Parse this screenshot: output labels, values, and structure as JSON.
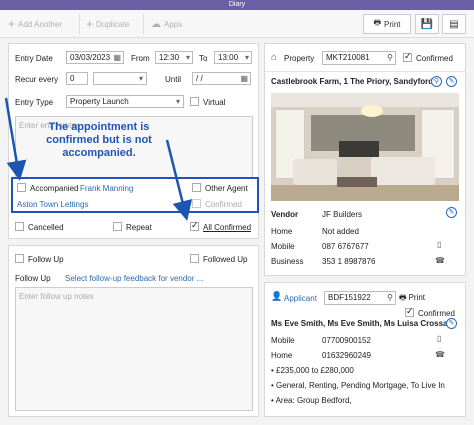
{
  "window": {
    "title": "Diary"
  },
  "toolbar": {
    "add_another": "Add Another",
    "duplicate": "Duplicate",
    "apps": "Apps",
    "print": "Print"
  },
  "entry": {
    "entry_date_label": "Entry Date",
    "entry_date": "03/03/2023",
    "from_label": "From",
    "from_time": "12:30",
    "to_label": "To",
    "to_time": "13:00",
    "recur_label": "Recur every",
    "recur_value": "0",
    "until_label": "Until",
    "until_value": "/ /",
    "entry_type_label": "Entry Type",
    "entry_type_value": "Property Launch",
    "virtual_label": "Virtual",
    "notes_placeholder": "Enter entry notes"
  },
  "annotation": {
    "text": "The appointment is confirmed but is not accompanied."
  },
  "accompanied": {
    "accompanied_label": "Accompanied",
    "accompanied_by": "Frank Manning",
    "other_agent_label": "Other Agent",
    "company": "Aston Town Lettings",
    "confirmed_label": "Confirmed"
  },
  "status": {
    "cancelled_label": "Cancelled",
    "repeat_label": "Repeat",
    "all_confirmed_label": "All Confirmed"
  },
  "followup": {
    "follow_up_label": "Follow Up",
    "followed_up_label": "Followed Up",
    "follow_up_field_label": "Follow Up",
    "feedback_link": "Select follow-up feedback for vendor ...",
    "notes_placeholder": "Enter follow up notes"
  },
  "property": {
    "label": "Property",
    "ref": "MKT210081",
    "confirmed_label": "Confirmed",
    "address": "Castlebrook Farm, 1 The Priory, Sandyford",
    "vendor_label": "Vendor",
    "vendor_name": "JF Builders",
    "rows": [
      {
        "label": "Home",
        "value": "Not added"
      },
      {
        "label": "Mobile",
        "value": "087 6767677"
      },
      {
        "label": "Business",
        "value": "353 1 8987876"
      }
    ]
  },
  "applicant": {
    "label": "Applicant",
    "ref": "BDF151922",
    "print_label": "Print",
    "confirmed_label": "Confirmed",
    "name": "Ms Eve Smith, Ms Eve Smith, Ms Luisa Crossan",
    "rows": [
      {
        "label": "Mobile",
        "value": "07700900152"
      },
      {
        "label": "Home",
        "value": "01632960249"
      }
    ],
    "bullets": [
      "£235,000 to £280,000",
      "General, Renting, Pending Mortgage, To Live In",
      "Area: Group Bedford,"
    ]
  },
  "colors": {
    "title_bar": "#6b60a6",
    "annotation": "#1e55b3",
    "link": "#2a6bb5"
  }
}
